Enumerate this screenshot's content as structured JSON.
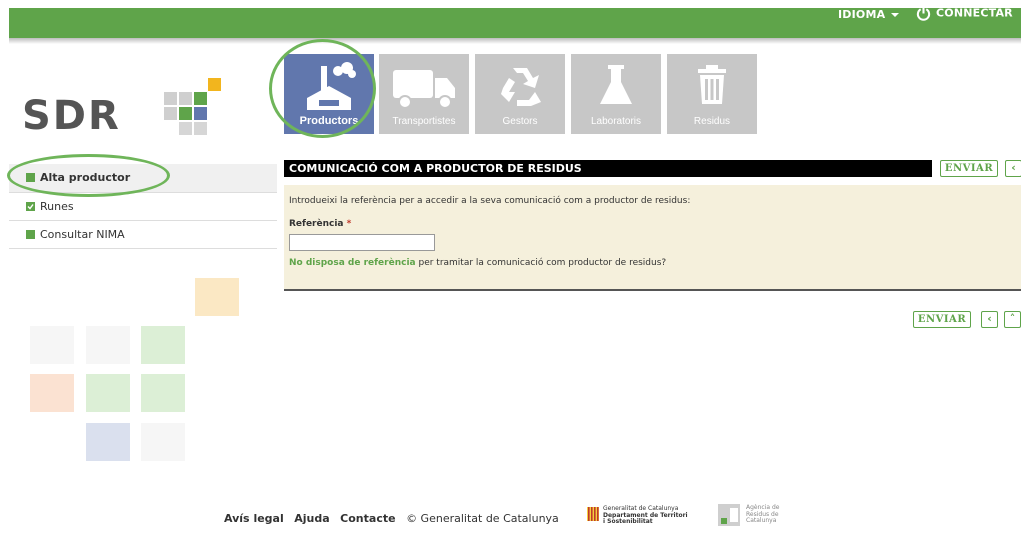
{
  "topbar": {
    "language_label": "IDIOMA",
    "connect_label": "CONNECTAR"
  },
  "logo": {
    "text": "SDR"
  },
  "categories": [
    {
      "label": "Productors",
      "icon": "factory-icon",
      "active": true
    },
    {
      "label": "Transportistes",
      "icon": "truck-icon",
      "active": false
    },
    {
      "label": "Gestors",
      "icon": "recycle-icon",
      "active": false
    },
    {
      "label": "Laboratoris",
      "icon": "flask-icon",
      "active": false
    },
    {
      "label": "Residus",
      "icon": "trash-icon",
      "active": false
    }
  ],
  "sidebar": {
    "items": [
      {
        "label": "Alta productor",
        "icon": "square-icon",
        "selected": true
      },
      {
        "label": "Runes",
        "icon": "check-square-icon",
        "selected": false
      },
      {
        "label": "Consultar NIMA",
        "icon": "square-icon",
        "selected": false
      }
    ]
  },
  "main": {
    "title": "COMUNICACIÓ COM A PRODUCTOR DE RESIDUS",
    "intro": "Introdueixi la referència per a accedir a la seva comunicació com a productor de residus:",
    "reference_label": "Referència",
    "required_mark": "*",
    "reference_value": "",
    "no_reference_link": "No disposa de referència",
    "no_reference_rest": "per tramitar la comunicació com productor de residus?",
    "send_label": "ENVIAR"
  },
  "footer": {
    "legal": "Avís legal",
    "help": "Ajuda",
    "contact": "Contacte",
    "copyright": "© Generalitat de Catalunya",
    "gencat_line1": "Generalitat de Catalunya",
    "gencat_line2": "Departament de Territori",
    "gencat_line3": "i Sostenibilitat",
    "arc_line1": "Agència de",
    "arc_line2": "Residus de",
    "arc_line3": "Catalunya"
  },
  "colors": {
    "brand_green": "#5fa44a",
    "active_tile": "#6177ad",
    "inactive_tile": "#c7c7c7",
    "form_bg": "#f5f0dc"
  }
}
